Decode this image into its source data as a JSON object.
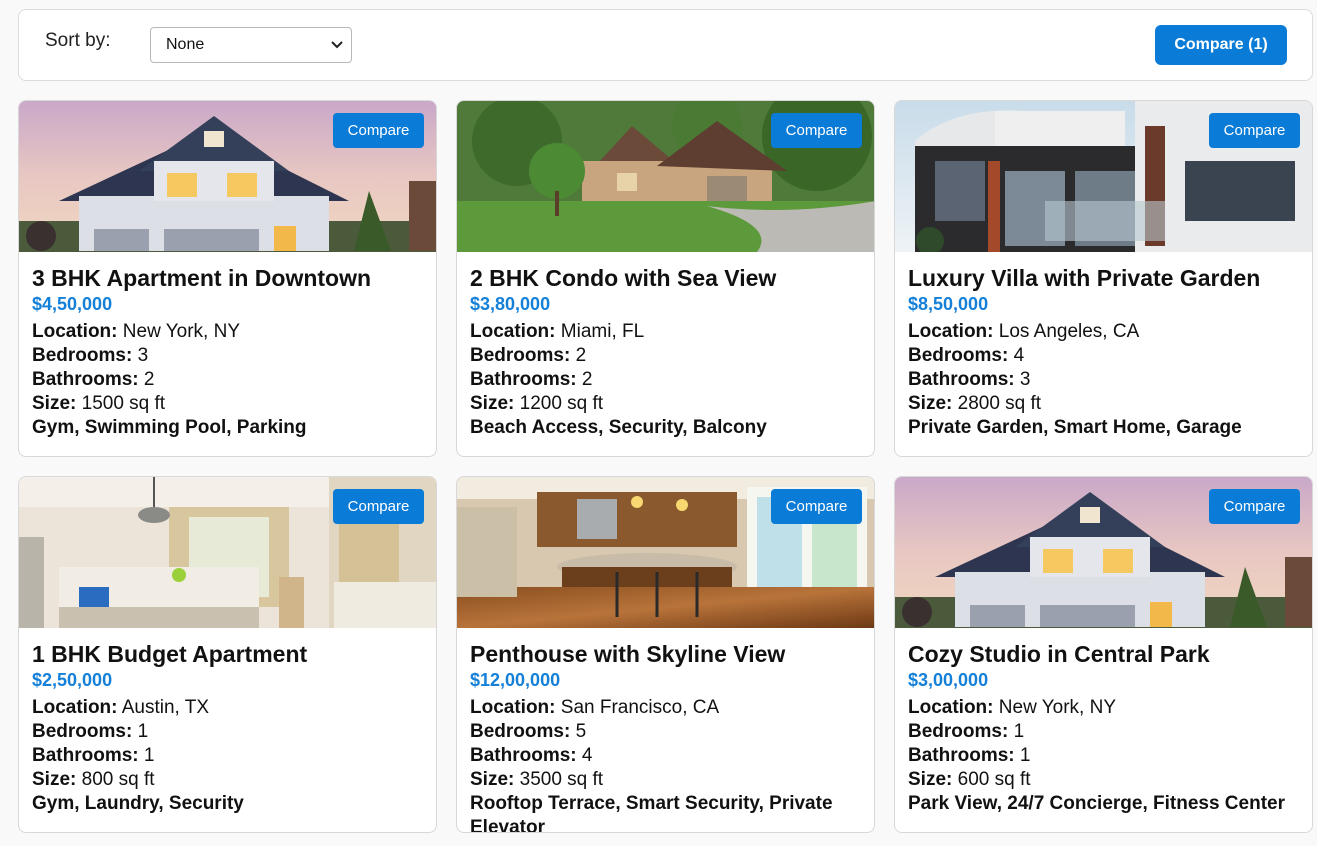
{
  "toolbar": {
    "sort_label": "Sort by:",
    "sort_value": "None",
    "compare_label": "Compare (1)"
  },
  "labels": {
    "compare": "Compare",
    "location": "Location:",
    "bedrooms": "Bedrooms:",
    "bathrooms": "Bathrooms:",
    "size": "Size:"
  },
  "colors": {
    "accent": "#0a7bd6",
    "price": "#1580d8"
  },
  "properties": [
    {
      "title": "3 BHK Apartment in Downtown",
      "price": "$4,50,000",
      "location": "New York, NY",
      "bedrooms": "3",
      "bathrooms": "2",
      "size": "1500 sq ft",
      "amenities": "Gym, Swimming Pool, Parking",
      "image": "suburban-house-photo"
    },
    {
      "title": "2 BHK Condo with Sea View",
      "price": "$3,80,000",
      "location": "Miami, FL",
      "bedrooms": "2",
      "bathrooms": "2",
      "size": "1200 sq ft",
      "amenities": "Beach Access, Security, Balcony",
      "image": "stone-house-garden-photo"
    },
    {
      "title": "Luxury Villa with Private Garden",
      "price": "$8,50,000",
      "location": "Los Angeles, CA",
      "bedrooms": "4",
      "bathrooms": "3",
      "size": "2800 sq ft",
      "amenities": "Private Garden, Smart Home, Garage",
      "image": "modern-villa-photo"
    },
    {
      "title": "1 BHK Budget Apartment",
      "price": "$2,50,000",
      "location": "Austin, TX",
      "bedrooms": "1",
      "bathrooms": "1",
      "size": "800 sq ft",
      "amenities": "Gym, Laundry, Security",
      "image": "bedroom-interior-photo"
    },
    {
      "title": "Penthouse with Skyline View",
      "price": "$12,00,000",
      "location": "San Francisco, CA",
      "bedrooms": "5",
      "bathrooms": "4",
      "size": "3500 sq ft",
      "amenities": "Rooftop Terrace, Smart Security, Private Elevator",
      "image": "kitchen-interior-photo"
    },
    {
      "title": "Cozy Studio in Central Park",
      "price": "$3,00,000",
      "location": "New York, NY",
      "bedrooms": "1",
      "bathrooms": "1",
      "size": "600 sq ft",
      "amenities": "Park View, 24/7 Concierge, Fitness Center",
      "image": "suburban-house-photo"
    }
  ]
}
